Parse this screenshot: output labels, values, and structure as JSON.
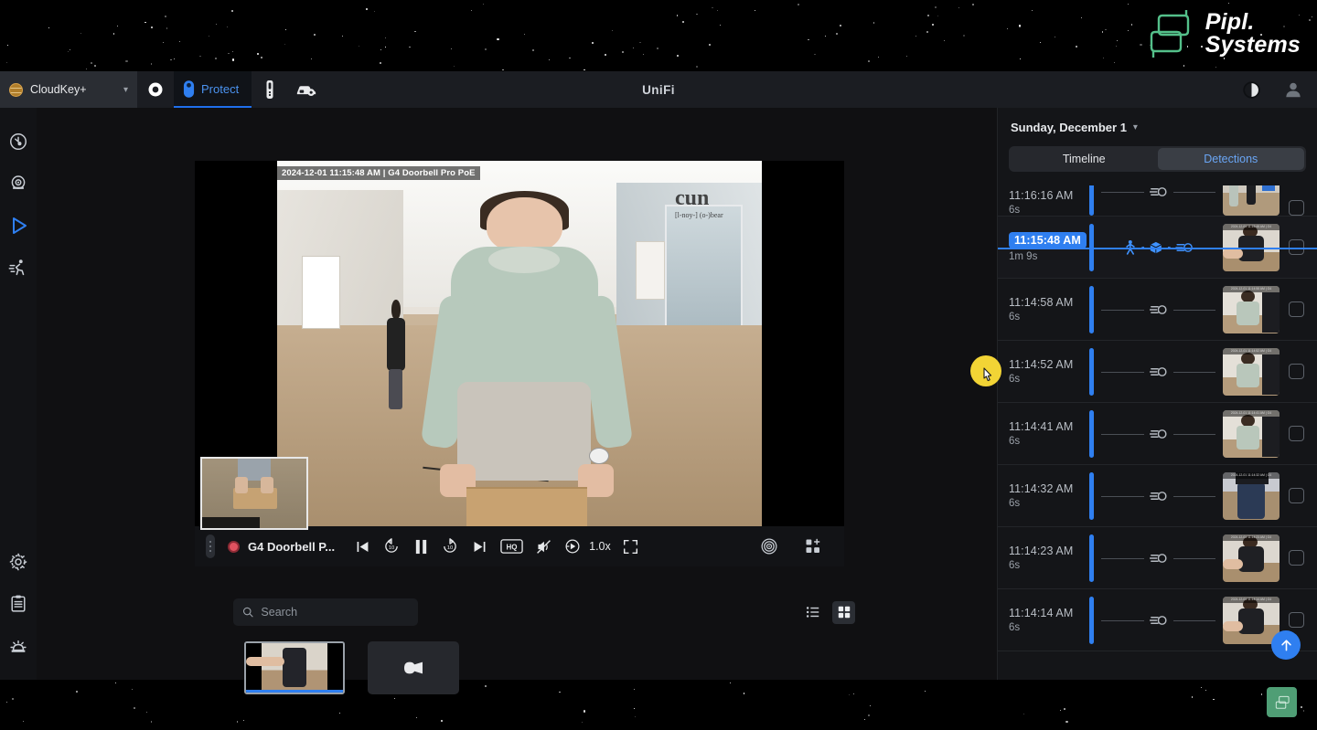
{
  "brand": {
    "line1": "Pipl.",
    "line2": "Systems"
  },
  "header": {
    "console_name": "CloudKey+",
    "app_title": "UniFi",
    "protect_label": "Protect",
    "icons": {
      "globe": "globe-icon",
      "chevron": "chevron-down-icon",
      "console": "console-target-icon",
      "protect": "protect-shield-icon",
      "device": "device-icon",
      "drive": "drive-gear-icon",
      "theme": "contrast-theme-icon",
      "account": "user-avatar-icon"
    }
  },
  "rail": {
    "items": [
      {
        "name": "sidebar-item-dashboard",
        "icon": "dashboard-clock-icon",
        "active": false
      },
      {
        "name": "sidebar-item-cameras",
        "icon": "camera-icon",
        "active": false
      },
      {
        "name": "sidebar-item-playback",
        "icon": "play-triangle-icon",
        "active": true
      },
      {
        "name": "sidebar-item-detections",
        "icon": "person-running-icon",
        "active": false
      },
      {
        "name": "sidebar-item-settings",
        "icon": "gear-icon",
        "active": false
      },
      {
        "name": "sidebar-item-logs",
        "icon": "clipboard-list-icon",
        "active": false
      },
      {
        "name": "sidebar-item-alarms",
        "icon": "alarm-siren-icon",
        "active": false
      }
    ]
  },
  "player": {
    "overlay_stamp": "2024-12-01 11:15:48 AM  |  G4 Doorbell Pro PoE",
    "camera_name": "G4 Doorbell P...",
    "speed": "1.0x",
    "quality_label": "HQ",
    "controls": [
      {
        "name": "record-indicator",
        "icon": "record-dot-icon"
      },
      {
        "name": "previous-event-button",
        "icon": "skip-previous-icon"
      },
      {
        "name": "rewind-10-button",
        "icon": "rewind-10-icon"
      },
      {
        "name": "pause-button",
        "icon": "pause-icon"
      },
      {
        "name": "forward-10-button",
        "icon": "forward-10-icon"
      },
      {
        "name": "next-event-button",
        "icon": "skip-next-icon"
      },
      {
        "name": "quality-button",
        "icon": "hq-badge-icon"
      },
      {
        "name": "mute-button",
        "icon": "speaker-muted-icon"
      },
      {
        "name": "playback-speed-button",
        "icon": "speed-icon"
      },
      {
        "name": "fullscreen-button",
        "icon": "fullscreen-icon"
      },
      {
        "name": "motion-detection-button",
        "icon": "target-rings-icon"
      },
      {
        "name": "add-view-button",
        "icon": "add-grid-icon"
      }
    ]
  },
  "search": {
    "placeholder": "Search",
    "value": "",
    "icon": "search-icon",
    "views": [
      {
        "name": "list-view-button",
        "icon": "list-view-icon",
        "active": false
      },
      {
        "name": "grid-view-button",
        "icon": "grid-view-icon",
        "active": true
      }
    ]
  },
  "camera_thumbs": [
    {
      "name": "camera-thumb-doorbell",
      "selected": true,
      "label": ""
    },
    {
      "name": "camera-thumb-placeholder",
      "selected": false,
      "icon": "camera-placeholder-icon",
      "label": ""
    }
  ],
  "right_panel": {
    "date": "Sunday, December 1",
    "date_chevron": "chevron-down-icon",
    "tabs": [
      {
        "label": "Timeline",
        "active": false,
        "name": "tab-timeline"
      },
      {
        "label": "Detections",
        "active": true,
        "name": "tab-detections"
      }
    ],
    "scroll_top_button": {
      "name": "scroll-to-top-button",
      "icon": "arrow-up-icon"
    },
    "detections": [
      {
        "time": "11:16:16 AM",
        "duration": "6s",
        "selected": false,
        "clipped": true,
        "icons": [
          "motion-icon"
        ],
        "art": "a1"
      },
      {
        "time": "11:15:48 AM",
        "duration": "1m 9s",
        "selected": true,
        "clipped": false,
        "icons": [
          "person-icon",
          "package-icon",
          "motion-icon"
        ],
        "art": "a2"
      },
      {
        "time": "11:14:58 AM",
        "duration": "6s",
        "selected": false,
        "clipped": false,
        "icons": [
          "motion-icon"
        ],
        "art": "a3"
      },
      {
        "time": "11:14:52 AM",
        "duration": "6s",
        "selected": false,
        "clipped": false,
        "icons": [
          "motion-icon"
        ],
        "art": "a3"
      },
      {
        "time": "11:14:41 AM",
        "duration": "6s",
        "selected": false,
        "clipped": false,
        "icons": [
          "motion-icon"
        ],
        "art": "a3"
      },
      {
        "time": "11:14:32 AM",
        "duration": "6s",
        "selected": false,
        "clipped": false,
        "icons": [
          "motion-icon"
        ],
        "art": "a4"
      },
      {
        "time": "11:14:23 AM",
        "duration": "6s",
        "selected": false,
        "clipped": false,
        "icons": [
          "motion-icon"
        ],
        "art": "a2"
      },
      {
        "time": "11:14:14 AM",
        "duration": "6s",
        "selected": false,
        "clipped": false,
        "icons": [
          "motion-icon"
        ],
        "art": "a2"
      }
    ]
  },
  "colors": {
    "accent_blue": "#2f7ff0",
    "link_blue": "#6aa6f5",
    "brand_green": "#4f9e75",
    "cursor_highlight": "#f2d435",
    "record_red": "#e05260"
  }
}
